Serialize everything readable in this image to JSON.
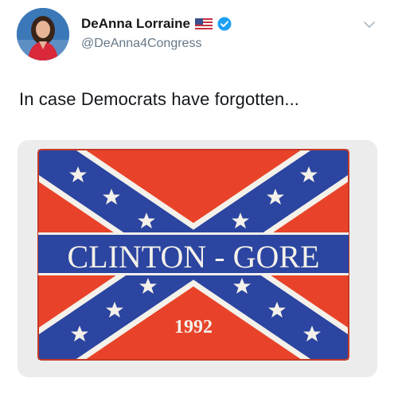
{
  "tweet": {
    "display_name": "DeAnna Lorraine",
    "handle": "@DeAnna4Congress",
    "text": "In case Democrats have forgotten...",
    "badges": [
      "us-flag-emoji",
      "verified-check-icon"
    ],
    "menu_icon": "chevron-down-icon",
    "accent_color": "#1da1f2"
  },
  "media": {
    "button_text": "CLINTON - GORE",
    "year": "1992",
    "colors": {
      "red": "#e8432a",
      "blue": "#2b45a0",
      "white": "#f4f1ea"
    }
  }
}
